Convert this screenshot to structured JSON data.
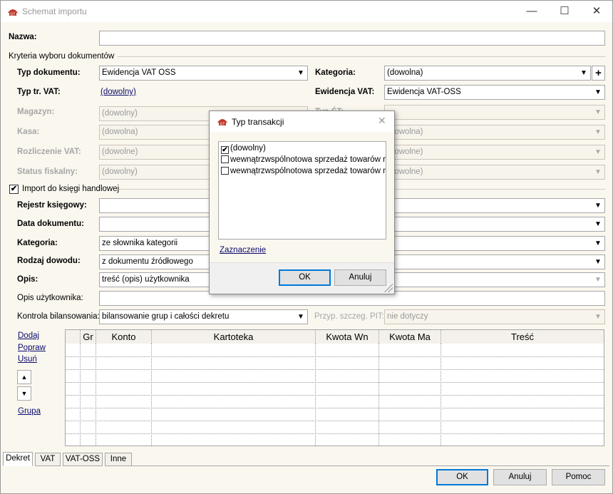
{
  "window": {
    "title": "Schemat importu",
    "minimize": "—",
    "maximize": "☐",
    "close": "✕"
  },
  "form": {
    "name_label": "Nazwa:",
    "name_value": "",
    "criteria_group": "Kryteria wyboru dokumentów",
    "doc_type_label": "Typ dokumentu:",
    "doc_type_value": "Ewidencja VAT OSS",
    "category_label": "Kategoria:",
    "category_value": "(dowolna)",
    "vat_type_label": "Typ tr. VAT:",
    "vat_type_value": "(dowolny)",
    "vat_register_label": "Ewidencja VAT:",
    "vat_register_value": "Ewidencja VAT-OSS",
    "warehouse_label": "Magazyn:",
    "warehouse_value": "(dowolny)",
    "hidden_label_right": "Typ ŚT:",
    "cash_label": "Kasa:",
    "cash_value": "(dowolna)",
    "cash_right_value": "(dowolna)",
    "vat_settle_label": "Rozliczenie VAT:",
    "vat_settle_value": "(dowolne)",
    "vat_settle_right_value": "(dowolne)",
    "fiscal_label": "Status fiskalny:",
    "fiscal_value": "(dowolny)",
    "fiscal_right_value": "(dowolne)",
    "import_group": "Import do księgi handlowej",
    "import_checked": true,
    "ledger_label": "Rejestr księgowy:",
    "ledger_value": "",
    "doc_date_label": "Data dokumentu:",
    "doc_date_value": "",
    "cat2_label": "Kategoria:",
    "cat2_value": "ze słownika kategorii",
    "proof_label": "Rodzaj dowodu:",
    "proof_value": "z dokumentu źródłowego",
    "desc_label": "Opis:",
    "desc_value": "treść (opis) użytkownika",
    "user_desc_label": "Opis użytkownika:",
    "user_desc_value": "",
    "balance_label": "Kontrola bilansowania:",
    "balance_value": "bilansowanie grup i całości dekretu",
    "pit_label": "Przyp. szczeg. PIT:",
    "pit_value": "nie dotyczy"
  },
  "side_links": {
    "add": "Dodaj",
    "edit": "Popraw",
    "remove": "Usuń",
    "group": "Grupa",
    "up": "▲",
    "down": "▼"
  },
  "grid": {
    "headers": [
      "Gr",
      "Konto",
      "Kartoteka",
      "Kwota Wn",
      "Kwota Ma",
      "Treść"
    ],
    "row_count": 7
  },
  "tabs": [
    "Dekret",
    "VAT",
    "VAT-OSS",
    "Inne"
  ],
  "buttons": {
    "ok": "OK",
    "cancel": "Anuluj",
    "help": "Pomoc"
  },
  "dialog": {
    "title": "Typ transakcji",
    "close": "✕",
    "items": [
      {
        "label": "(dowolny)",
        "checked": true
      },
      {
        "label": "wewnątrzwspólnotowa sprzedaż towarów na",
        "checked": false
      },
      {
        "label": "wewnątrzwspólnotowa sprzedaż towarów na",
        "checked": false
      }
    ],
    "selection_link": "Zaznaczenie",
    "ok": "OK",
    "cancel": "Anuluj"
  },
  "icons": {
    "dropdown": "▼",
    "plus": "+",
    "check": "✔"
  },
  "colors": {
    "accent": "#0078d7",
    "window_bg": "#faf7ef",
    "app_icon": "#c0392b"
  }
}
